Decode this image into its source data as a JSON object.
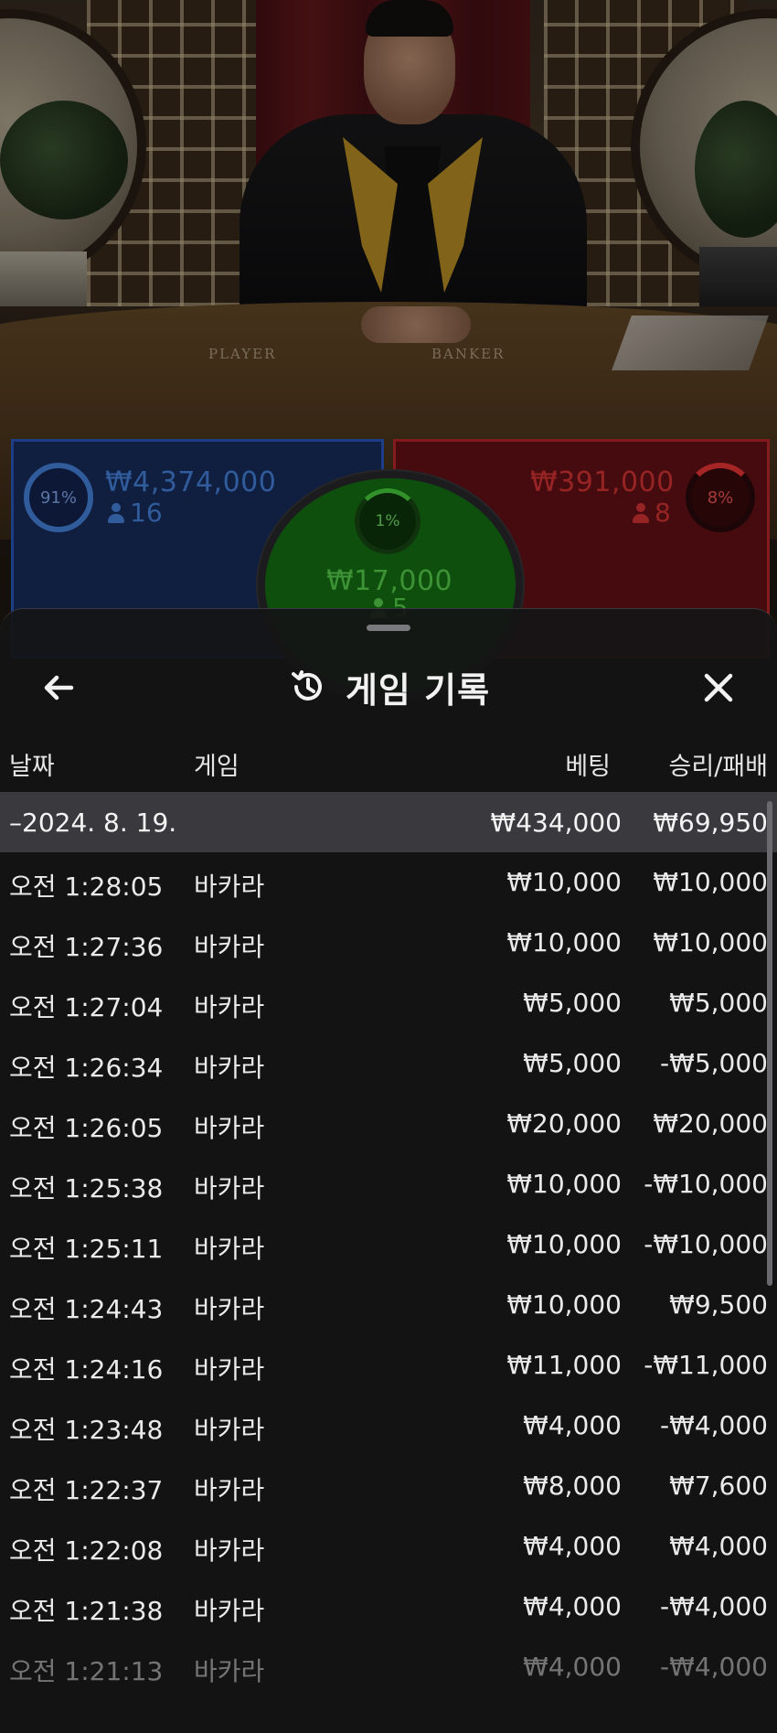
{
  "video": {
    "table_player_label": "PLAYER",
    "table_banker_label": "BANKER"
  },
  "bets": {
    "player": {
      "percent": "91%",
      "amount": "₩4,374,000",
      "count": "16"
    },
    "tie": {
      "percent": "1%",
      "amount": "₩17,000",
      "count": "5"
    },
    "banker": {
      "percent": "8%",
      "amount": "₩391,000",
      "count": "8"
    },
    "colors": {
      "player": "#2f5fcf",
      "banker": "#c92a2e",
      "tie": "#4be040"
    }
  },
  "sheet": {
    "title": "게임 기록",
    "icons": {
      "back": "arrow-left-icon",
      "history": "history-icon",
      "close": "close-icon"
    },
    "columns": {
      "date": "날짜",
      "game": "게임",
      "bet": "베팅",
      "result": "승리/패배"
    },
    "summary": {
      "date": "–2024. 8. 19.",
      "bet": "₩434,000",
      "result": "₩69,950"
    },
    "rows": [
      {
        "time": "오전 1:28:05",
        "game": "바카라",
        "bet": "₩10,000",
        "result": "₩10,000"
      },
      {
        "time": "오전 1:27:36",
        "game": "바카라",
        "bet": "₩10,000",
        "result": "₩10,000"
      },
      {
        "time": "오전 1:27:04",
        "game": "바카라",
        "bet": "₩5,000",
        "result": "₩5,000"
      },
      {
        "time": "오전 1:26:34",
        "game": "바카라",
        "bet": "₩5,000",
        "result": "-₩5,000"
      },
      {
        "time": "오전 1:26:05",
        "game": "바카라",
        "bet": "₩20,000",
        "result": "₩20,000"
      },
      {
        "time": "오전 1:25:38",
        "game": "바카라",
        "bet": "₩10,000",
        "result": "-₩10,000"
      },
      {
        "time": "오전 1:25:11",
        "game": "바카라",
        "bet": "₩10,000",
        "result": "-₩10,000"
      },
      {
        "time": "오전 1:24:43",
        "game": "바카라",
        "bet": "₩10,000",
        "result": "₩9,500"
      },
      {
        "time": "오전 1:24:16",
        "game": "바카라",
        "bet": "₩11,000",
        "result": "-₩11,000"
      },
      {
        "time": "오전 1:23:48",
        "game": "바카라",
        "bet": "₩4,000",
        "result": "-₩4,000"
      },
      {
        "time": "오전 1:22:37",
        "game": "바카라",
        "bet": "₩8,000",
        "result": "₩7,600"
      },
      {
        "time": "오전 1:22:08",
        "game": "바카라",
        "bet": "₩4,000",
        "result": "₩4,000"
      },
      {
        "time": "오전 1:21:38",
        "game": "바카라",
        "bet": "₩4,000",
        "result": "-₩4,000"
      },
      {
        "time": "오전 1:21:13",
        "game": "바카라",
        "bet": "₩4,000",
        "result": "-₩4,000"
      }
    ]
  }
}
